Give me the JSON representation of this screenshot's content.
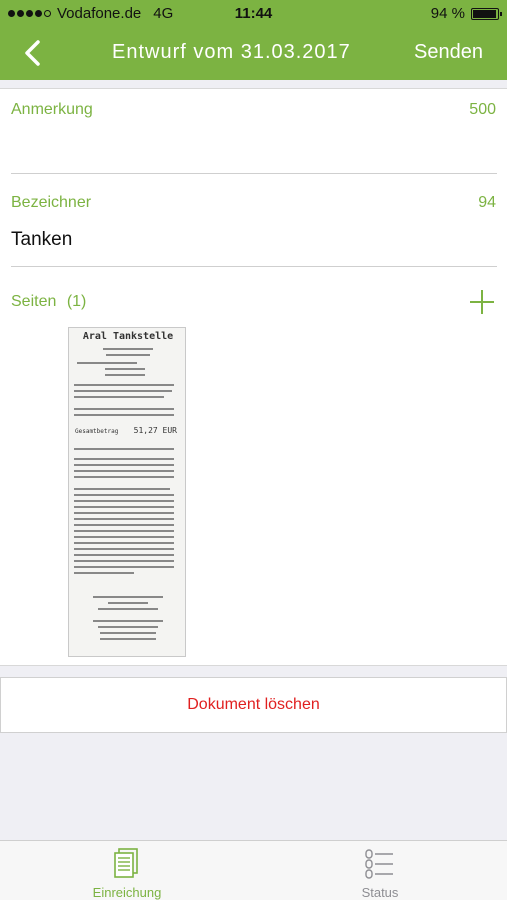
{
  "status_bar": {
    "carrier": "Vodafone.de",
    "network": "4G",
    "time": "11:44",
    "battery": "94 %",
    "battery_level": 0.94
  },
  "nav": {
    "title": "Entwurf vom 31.03.2017",
    "send_label": "Senden"
  },
  "fields": {
    "anmerkung": {
      "label": "Anmerkung",
      "count": "500",
      "value": ""
    },
    "bezeichner": {
      "label": "Bezeichner",
      "count": "94",
      "value": "Tanken"
    }
  },
  "pages": {
    "label": "Seiten",
    "count": "(1)"
  },
  "receipt": {
    "station": "Aral Tankstelle",
    "total_label": "Gesamtbetrag",
    "total": "51,27 EUR"
  },
  "delete_label": "Dokument löschen",
  "tabs": [
    {
      "label": "Einreichung",
      "icon": "document-stack-icon",
      "active": true
    },
    {
      "label": "Status",
      "icon": "status-list-icon",
      "active": false
    }
  ],
  "colors": {
    "accent": "#7cb342",
    "destructive": "#e02020"
  }
}
